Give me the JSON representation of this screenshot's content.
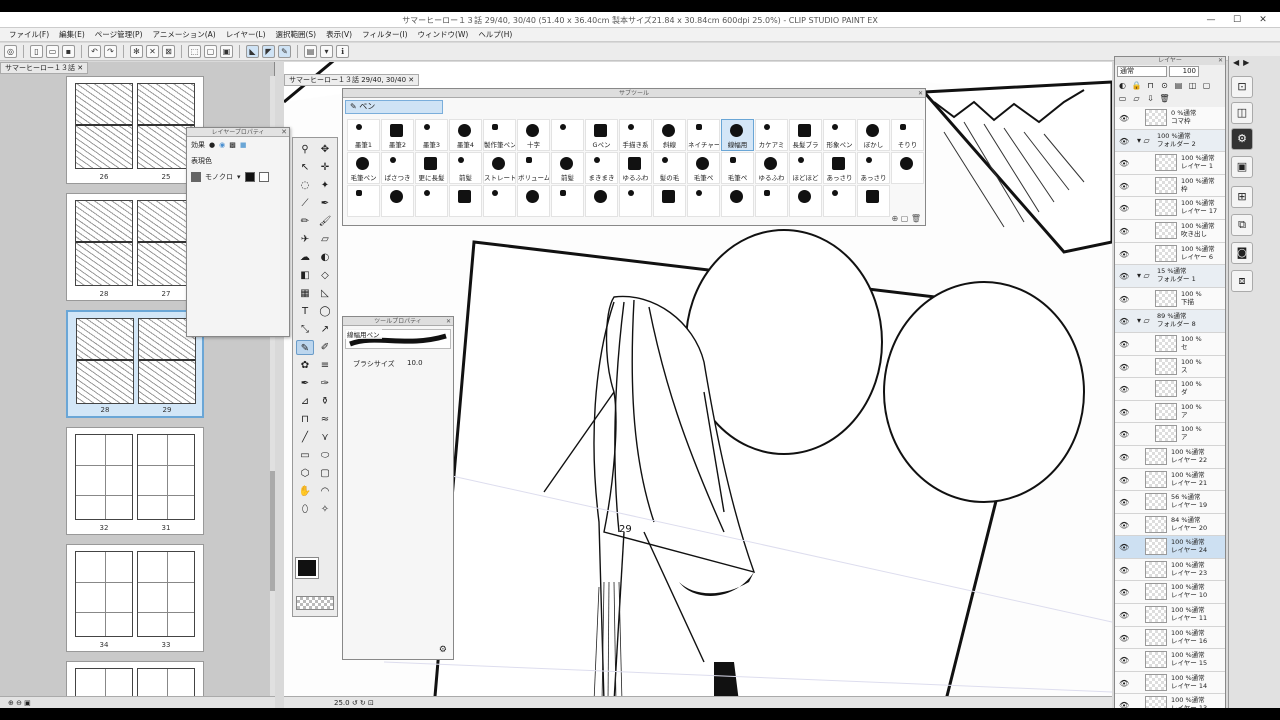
{
  "window": {
    "title": "サマーヒーロー１３話 29/40, 30/40 (51.40 x 36.40cm 製本サイズ21.84 x 30.84cm 600dpi 25.0%) - CLIP STUDIO PAINT EX",
    "minimize": "—",
    "maximize": "☐",
    "close": "✕"
  },
  "menu": [
    "ファイル(F)",
    "編集(E)",
    "ページ管理(P)",
    "アニメーション(A)",
    "レイヤー(L)",
    "選択範囲(S)",
    "表示(V)",
    "フィルター(I)",
    "ウィンドウ(W)",
    "ヘルプ(H)"
  ],
  "page_manager": {
    "tab": "サマーヒーロー１３話 ✕",
    "spreads": [
      {
        "left": "26",
        "right": "25",
        "selected": false
      },
      {
        "left": "28",
        "right": "27",
        "selected": false
      },
      {
        "left": "28",
        "right": "29",
        "selected": true
      },
      {
        "left": "32",
        "right": "31",
        "selected": false
      },
      {
        "left": "34",
        "right": "33",
        "selected": false
      },
      {
        "left": "",
        "right": "",
        "selected": false
      }
    ]
  },
  "layer_property": {
    "title": "レイヤープロパティ",
    "effect_label": "効果",
    "color_label": "表現色",
    "color_value": "モノクロ"
  },
  "canvas": {
    "tab": "サマーヒーロー１３話 29/40, 30/40 ✕",
    "page_number": "29",
    "zoom": "25.0"
  },
  "sub_tool": {
    "title": "サブツール",
    "group": "ペン",
    "brushes": [
      "墨筆1",
      "墨筆2",
      "墨筆3",
      "墨筆4",
      "製作筆ペン",
      "十字",
      "",
      "Gペン",
      "手描き系",
      "斜線",
      "ネイチャー",
      "線幅用",
      "カケアミ",
      "長髪ブラ",
      "形象ペン",
      "ぼかし",
      "そりり",
      "毛筆ペン",
      "ぱさつき",
      "更に長髪",
      "前髪",
      "ストレート",
      "ボリューム",
      "前髪",
      "まきまき",
      "ゆるふわ",
      "髪の毛",
      "毛筆ぺ",
      "毛筆ぺ",
      "ゆるふわ",
      "ほどほど",
      "あっさり",
      "あっさり",
      "",
      "",
      "",
      "",
      "",
      "",
      "",
      "",
      "",
      "",
      "",
      "",
      "",
      "",
      "",
      "",
      ""
    ]
  },
  "tool_property": {
    "title": "ツールプロパティ",
    "preview_label": "線幅用ペン",
    "brush_size_label": "ブラシサイズ",
    "brush_size_value": "10.0"
  },
  "layer_panel": {
    "title": "レイヤー",
    "blend_mode": "通常",
    "opacity": "100",
    "layers": [
      {
        "opacity": "0 %通常",
        "name": "コマ枠",
        "type": "frame",
        "indent": 0,
        "selected": false
      },
      {
        "opacity": "100 %通常",
        "name": "フォルダー 2",
        "type": "folder",
        "indent": 0,
        "selected": false
      },
      {
        "opacity": "100 %通常",
        "name": "レイヤー 1",
        "type": "layer",
        "indent": 1,
        "selected": false
      },
      {
        "opacity": "100 %通常",
        "name": "枠",
        "type": "layer",
        "indent": 1,
        "selected": false
      },
      {
        "opacity": "100 %通常",
        "name": "レイヤー 17",
        "type": "layer",
        "indent": 1,
        "selected": false
      },
      {
        "opacity": "100 %通常",
        "name": "吹き出し",
        "type": "layer",
        "indent": 1,
        "selected": false
      },
      {
        "opacity": "100 %通常",
        "name": "レイヤー 6",
        "type": "layer",
        "indent": 1,
        "selected": false
      },
      {
        "opacity": "15 %通常",
        "name": "フォルダー 1",
        "type": "folder",
        "indent": 0,
        "selected": false
      },
      {
        "opacity": "100 %",
        "name": "下描",
        "type": "layer",
        "indent": 1,
        "selected": false
      },
      {
        "opacity": "89 %通常",
        "name": "フォルダー 8",
        "type": "folder",
        "indent": 0,
        "selected": false
      },
      {
        "opacity": "100 %",
        "name": "セ",
        "type": "layer",
        "indent": 1,
        "selected": false
      },
      {
        "opacity": "100 %",
        "name": "ス",
        "type": "layer",
        "indent": 1,
        "selected": false
      },
      {
        "opacity": "100 %",
        "name": "ダ",
        "type": "layer",
        "indent": 1,
        "selected": false
      },
      {
        "opacity": "100 %",
        "name": "ア",
        "type": "layer",
        "indent": 1,
        "selected": false
      },
      {
        "opacity": "100 %",
        "name": "ア",
        "type": "layer",
        "indent": 1,
        "selected": false
      },
      {
        "opacity": "100 %通常",
        "name": "レイヤー 22",
        "type": "layer",
        "indent": 0,
        "selected": false
      },
      {
        "opacity": "100 %通常",
        "name": "レイヤー 21",
        "type": "layer",
        "indent": 0,
        "selected": false
      },
      {
        "opacity": "56 %通常",
        "name": "レイヤー 19",
        "type": "layer",
        "indent": 0,
        "selected": false
      },
      {
        "opacity": "84 %通常",
        "name": "レイヤー 20",
        "type": "layer",
        "indent": 0,
        "selected": false
      },
      {
        "opacity": "100 %通常",
        "name": "レイヤー 24",
        "type": "layer",
        "indent": 0,
        "selected": true
      },
      {
        "opacity": "100 %通常",
        "name": "レイヤー 23",
        "type": "layer",
        "indent": 0,
        "selected": false
      },
      {
        "opacity": "100 %通常",
        "name": "レイヤー 10",
        "type": "layer",
        "indent": 0,
        "selected": false
      },
      {
        "opacity": "100 %通常",
        "name": "レイヤー 11",
        "type": "layer",
        "indent": 0,
        "selected": false
      },
      {
        "opacity": "100 %通常",
        "name": "レイヤー 16",
        "type": "layer",
        "indent": 0,
        "selected": false
      },
      {
        "opacity": "100 %通常",
        "name": "レイヤー 15",
        "type": "layer",
        "indent": 0,
        "selected": false
      },
      {
        "opacity": "100 %通常",
        "name": "レイヤー 14",
        "type": "layer",
        "indent": 0,
        "selected": false
      },
      {
        "opacity": "100 %通常",
        "name": "レイヤー 13",
        "type": "layer",
        "indent": 0,
        "selected": false
      }
    ]
  },
  "colors": {
    "accent": "#6aa6d6",
    "selection": "#cde0f2",
    "main_color": "#111111"
  }
}
